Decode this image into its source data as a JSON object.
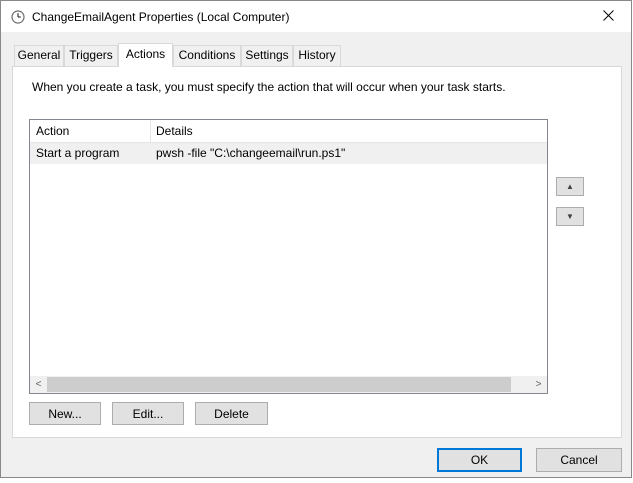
{
  "window": {
    "title": "ChangeEmailAgent Properties (Local Computer)",
    "icon": "clock-icon",
    "close_glyph": "✕"
  },
  "tabs": [
    {
      "label": "General",
      "active": false
    },
    {
      "label": "Triggers",
      "active": false
    },
    {
      "label": "Actions",
      "active": true
    },
    {
      "label": "Conditions",
      "active": false
    },
    {
      "label": "Settings",
      "active": false
    },
    {
      "label": "History",
      "active": false
    }
  ],
  "actions_page": {
    "intro": "When you create a task, you must specify the action that will occur when your task starts.",
    "columns": {
      "action": "Action",
      "details": "Details"
    },
    "rows": [
      {
        "action": "Start a program",
        "details": "pwsh -file \"C:\\changeemail\\run.ps1\""
      }
    ],
    "buttons": {
      "new": "New...",
      "edit": "Edit...",
      "delete": "Delete"
    },
    "move_up_glyph": "▲",
    "move_down_glyph": "▼",
    "scroll_left_glyph": "<",
    "scroll_right_glyph": ">"
  },
  "footer": {
    "ok": "OK",
    "cancel": "Cancel"
  },
  "colors": {
    "accent": "#0078d7",
    "selected_row": "#f0f0f0",
    "dialog_bg": "#f0f0f0"
  }
}
